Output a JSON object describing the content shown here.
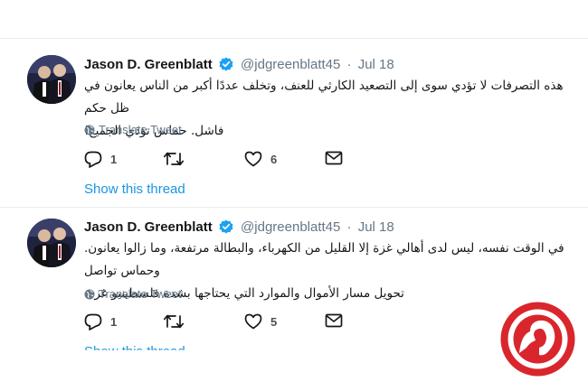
{
  "tweets": [
    {
      "name": "Jason D. Greenblatt",
      "handle": "@jdgreenblatt45",
      "separator": "·",
      "date": "Jul 18",
      "text_lines": [
        "هذه التصرفات لا تؤدي سوى إلى التصعيد الكارثي للعنف، وتخلف عددًا أكبر من الناس يعانون في ظل حكم",
        "فاشل. حماس تؤذي الجميع!"
      ],
      "translate_label": "Translate Tweet",
      "reply_count": "1",
      "retweet_count": "",
      "like_count": "6",
      "show_thread": "Show this thread"
    },
    {
      "name": "Jason D. Greenblatt",
      "handle": "@jdgreenblatt45",
      "separator": "·",
      "date": "Jul 18",
      "text_lines": [
        "في الوقت نفسه، ليس لدى أهالي غزة إلا القليل من الكهرباء، والبطالة مرتفعة، وما زالوا يعانون. وحماس تواصل",
        "تحويل مسار الأموال والموارد التي يحتاجها بشدة فلسطينيو غزة."
      ],
      "translate_label": "Translate Tweet",
      "reply_count": "1",
      "retweet_count": "",
      "like_count": "5",
      "show_thread": "Show this thread"
    }
  ],
  "icons": {
    "verified": "verified-badge-icon",
    "translate": "globe-icon",
    "reply": "reply-icon",
    "retweet": "retweet-icon",
    "like": "heart-icon",
    "message": "envelope-icon",
    "watermark": "news-logo-icon"
  },
  "colors": {
    "link_blue": "#1b95e0",
    "verified_blue": "#1da1f2",
    "muted_gray": "#657786",
    "logo_red": "#d9262c"
  }
}
